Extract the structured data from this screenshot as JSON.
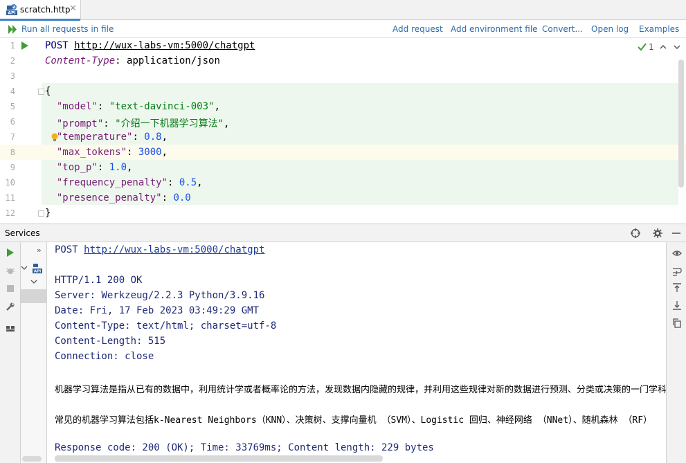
{
  "tab": {
    "label": "scratch.http",
    "close_glyph": "✕",
    "icon": "api-file-icon"
  },
  "toolbar": {
    "run_all_label": "Run all requests in file",
    "add_request": "Add request",
    "add_env_file": "Add environment file",
    "convert": "Convert...",
    "open_log": "Open log",
    "examples": "Examples"
  },
  "editor": {
    "indicator_count": "1",
    "lines": [
      {
        "n": "1"
      },
      {
        "n": "2"
      },
      {
        "n": "3"
      },
      {
        "n": "4"
      },
      {
        "n": "5"
      },
      {
        "n": "6"
      },
      {
        "n": "7"
      },
      {
        "n": "8"
      },
      {
        "n": "9"
      },
      {
        "n": "10"
      },
      {
        "n": "11"
      },
      {
        "n": "12"
      }
    ],
    "request_line": {
      "method": "POST",
      "url": "http://wux-labs-vm:5000/chatgpt"
    },
    "header": {
      "name": "Content-Type",
      "value": "application/json"
    },
    "json": {
      "open": "{",
      "close": "}",
      "model_key": "\"model\"",
      "model_val": "\"text-davinci-003\"",
      "prompt_key": "\"prompt\"",
      "prompt_val": "\"介绍一下机器学习算法\"",
      "temperature_key": "\"temperature\"",
      "temperature_val": "0.8",
      "max_tokens_key": "\"max_tokens\"",
      "max_tokens_val": "3000",
      "top_p_key": "\"top_p\"",
      "top_p_val": "1.0",
      "frequency_penalty_key": "\"frequency_penalty\"",
      "frequency_penalty_val": "0.5",
      "presence_penalty_key": "\"presence_penalty\"",
      "presence_penalty_val": "0.0"
    }
  },
  "services": {
    "title": "Services",
    "tree_expand_glyph": "»"
  },
  "response": {
    "request_method": "POST",
    "request_url": "http://wux-labs-vm:5000/chatgpt",
    "status": "HTTP/1.1 200 OK",
    "server": "Server: Werkzeug/2.2.3 Python/3.9.16",
    "date": "Date: Fri, 17 Feb 2023 03:49:29 GMT",
    "content_type": "Content-Type: text/html; charset=utf-8",
    "content_length": "Content-Length: 515",
    "connection": "Connection: close",
    "body_line_1": "机器学习算法是指从已有的数据中，利用统计学或者概率论的方法，发现数据内隐藏的规律，并利用这些规律对新的数据进行预测、分类或决策的一门学科",
    "body_line_2": "常见的机器学习算法包括k-Nearest Neighbors（KNN）、决策树、支撑向量机 （SVM）、Logistic 回归、神经网络 （NNet）、随机森林 （RF）",
    "summary": "Response code: 200 (OK); Time: 33769ms; Content length: 229 bytes"
  },
  "colors": {
    "accent": "#4083c9",
    "run_green": "#3f9c35",
    "link": "#2e6ba8",
    "code_bg": "#edf7ed"
  }
}
